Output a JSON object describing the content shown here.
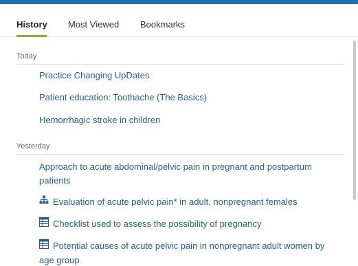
{
  "tabs": [
    {
      "label": "History",
      "active": true
    },
    {
      "label": "Most Viewed",
      "active": false
    },
    {
      "label": "Bookmarks",
      "active": false
    }
  ],
  "sections": [
    {
      "label": "Today"
    },
    {
      "label": "Yesterday"
    }
  ],
  "items": [
    {
      "label": "Practice Changing UpDates",
      "icon": ""
    },
    {
      "label": "Patient education: Toothache (The Basics)",
      "icon": ""
    },
    {
      "label": "Hemorrhagic stroke in children",
      "icon": ""
    },
    {
      "label": "Approach to acute abdominal/pelvic pain in pregnant and postpartum patients",
      "icon": ""
    },
    {
      "label": "Evaluation of acute pelvic pain* in adult, nonpregnant females",
      "icon": "algorithm-icon"
    },
    {
      "label": "Checklist used to assess the possibility of pregnancy",
      "icon": "table-icon"
    },
    {
      "label": "Potential causes of acute pelvic pain in nonpregnant adult women by age group",
      "icon": "table-icon"
    }
  ],
  "colors": {
    "accent_bar": "#1f6fb5",
    "tab_underline": "#84b135",
    "link": "#1f5f99"
  }
}
